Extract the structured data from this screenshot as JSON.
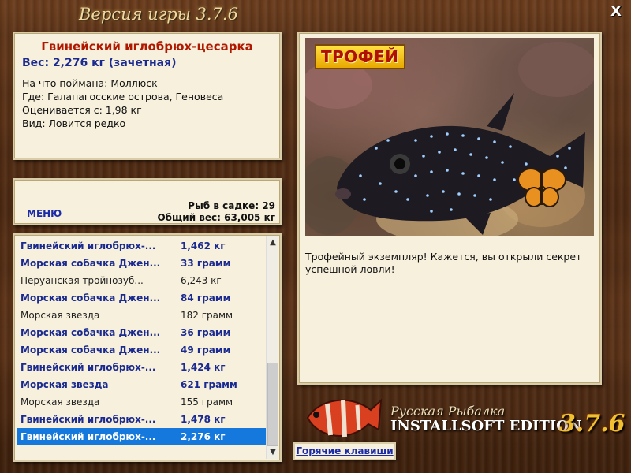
{
  "window": {
    "title": "Версия игры 3.7.6",
    "close_label": "X"
  },
  "info": {
    "fish_name": "Гвинейский иглобрюх-цесарка",
    "weight": "Вес: 2,276 кг (зачетная)",
    "bait": "На что поймана: Моллюск",
    "location": "Где: Галапагосские острова, Геновеса",
    "rated_from": "Оценивается с: 1,98 кг",
    "kind": "Вид: Ловится редко"
  },
  "menu": {
    "menu_label": "МЕНЮ",
    "fish_count": "Рыб в садке: 29",
    "total_weight": "Общий вес: 63,005 кг"
  },
  "catch_list": [
    {
      "name": "Гвинейский иглобрюх-...",
      "weight": "1,462 кг",
      "style": "bold"
    },
    {
      "name": "Морская собачка Джен...",
      "weight": "33 грамм",
      "style": "bold"
    },
    {
      "name": "Перуанская тройнозуб...",
      "weight": "6,243 кг",
      "style": "plain"
    },
    {
      "name": "Морская собачка Джен...",
      "weight": "84 грамм",
      "style": "bold"
    },
    {
      "name": "Морская звезда",
      "weight": "182 грамм",
      "style": "plain"
    },
    {
      "name": "Морская собачка Джен...",
      "weight": "36 грамм",
      "style": "bold"
    },
    {
      "name": "Морская собачка Джен...",
      "weight": "49 грамм",
      "style": "bold"
    },
    {
      "name": "Гвинейский иглобрюх-...",
      "weight": "1,424 кг",
      "style": "bold"
    },
    {
      "name": "Морская звезда",
      "weight": "621 грамм",
      "style": "bold"
    },
    {
      "name": "Морская звезда",
      "weight": "155 грамм",
      "style": "plain"
    },
    {
      "name": "Гвинейский иглобрюх-...",
      "weight": "1,478 кг",
      "style": "bold"
    },
    {
      "name": "Гвинейский иглобрюх-...",
      "weight": "2,276 кг",
      "style": "selected"
    }
  ],
  "trophy": {
    "badge": "ТРОФЕЙ",
    "message": "Трофейный экземпляр! Кажется, вы открыли секрет успешной ловли!"
  },
  "logo": {
    "subtitle": "Русская Рыбалка",
    "edition": "INSTALLSOFT EDITION",
    "version": "3.7.6"
  },
  "buttons": {
    "hotkeys": "Горячие клавиши"
  },
  "icons": {
    "close": "close-icon",
    "scroll_up": "chevron-up-icon",
    "scroll_down": "chevron-down-icon"
  }
}
